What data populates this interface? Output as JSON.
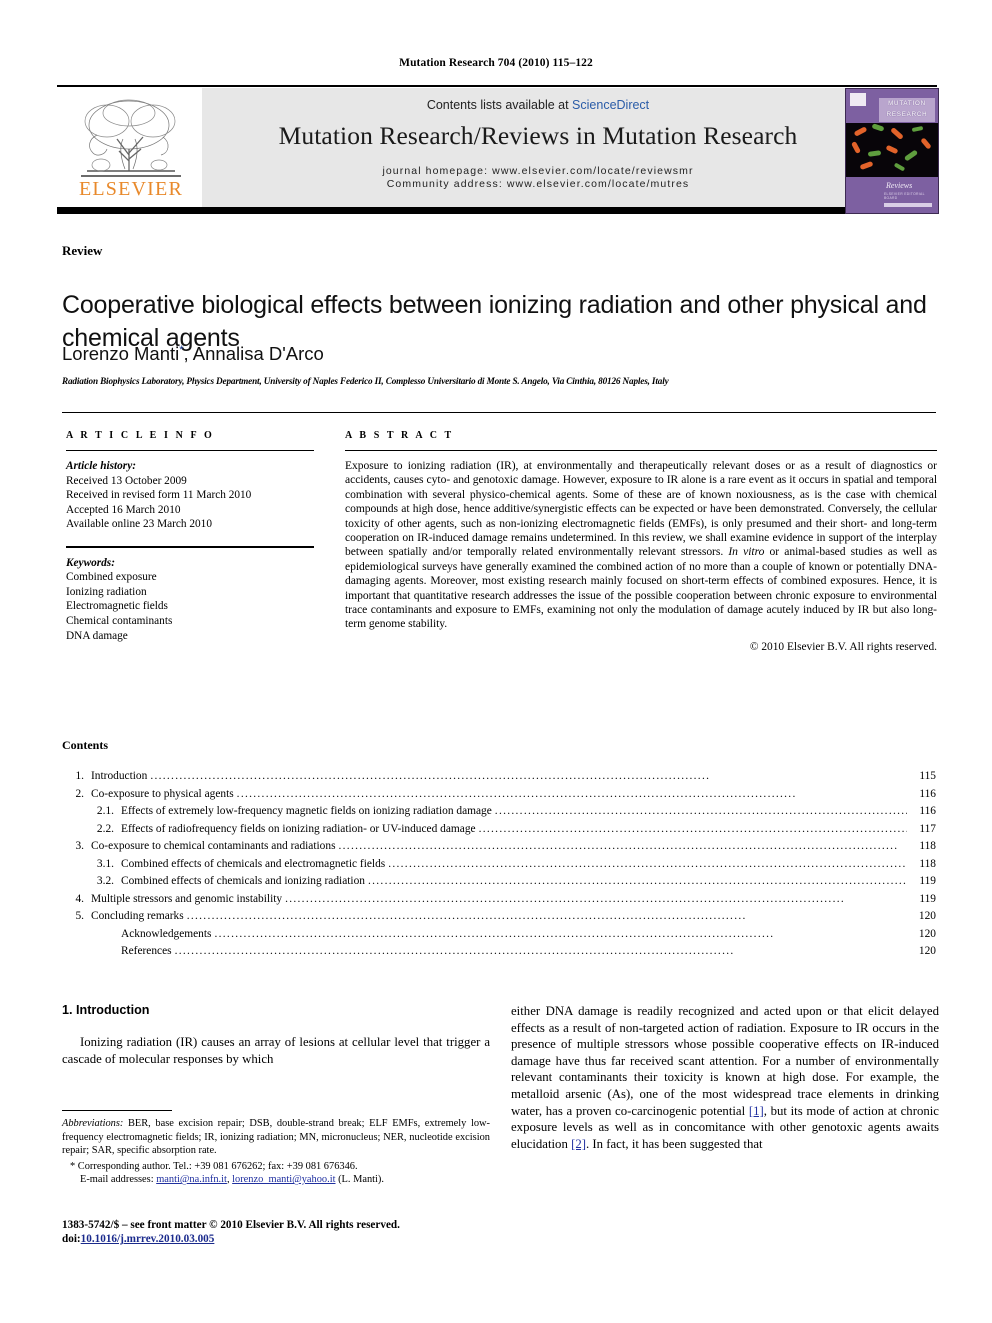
{
  "running_head": "Mutation Research 704 (2010) 115–122",
  "masthead": {
    "contents_prefix": "Contents lists available at ",
    "sciencedirect": "ScienceDirect",
    "journal_title": "Mutation Research/Reviews in Mutation Research",
    "homepage": "journal homepage: www.elsevier.com/locate/reviewsmr",
    "community": "Community address: www.elsevier.com/locate/mutres",
    "publisher_logo_text": "ELSEVIER",
    "accent_orange": "#e8892b",
    "band_gray": "#e7e7e7"
  },
  "cover": {
    "title_line1": "MUTATION",
    "title_line2": "RESEARCH",
    "reviews_label": "Reviews",
    "subtitle": "ELSEVIER EDITORIAL BOARD",
    "purple": "#7d60a1"
  },
  "article": {
    "type_label": "Review",
    "title": "Cooperative biological effects between ionizing radiation and other physical and chemical agents",
    "authors": "Lorenzo Manti",
    "author_marker": "*",
    "authors_rest": ", Annalisa D'Arco",
    "affiliation": "Radiation Biophysics Laboratory, Physics Department, University of Naples Federico II, Complesso Universitario di Monte S. Angelo, Via Cinthia, 80126 Naples, Italy"
  },
  "article_info": {
    "heading": "A R T I C L E   I N F O",
    "history_label": "Article history:",
    "history": [
      "Received 13 October 2009",
      "Received in revised form 11 March 2010",
      "Accepted 16 March 2010",
      "Available online 23 March 2010"
    ],
    "keywords_label": "Keywords:",
    "keywords": [
      "Combined exposure",
      "Ionizing radiation",
      "Electromagnetic fields",
      "Chemical contaminants",
      "DNA damage"
    ]
  },
  "abstract": {
    "heading": "A B S T R A C T",
    "part1": "Exposure to ionizing radiation (IR), at environmentally and therapeutically relevant doses or as a result of diagnostics or accidents, causes cyto- and genotoxic damage. However, exposure to IR alone is a rare event as it occurs in spatial and temporal combination with several physico-chemical agents. Some of these are of known noxiousness, as is the case with chemical compounds at high dose, hence additive/synergistic effects can be expected or have been demonstrated. Conversely, the cellular toxicity of other agents, such as non-ionizing electromagnetic fields (EMFs), is only presumed and their short- and long-term cooperation on IR-induced damage remains undetermined. In this review, we shall examine evidence in support of the interplay between spatially and/or temporally related environmentally relevant stressors. ",
    "italic1": "In vitro",
    "part2": " or animal-based studies as well as epidemiological surveys have generally examined the combined action of no more than a couple of known or potentially DNA-damaging agents. Moreover, most existing research mainly focused on short-term effects of combined exposures. Hence, it is important that quantitative research addresses the issue of the possible cooperation between chronic exposure to environmental trace contaminants and exposure to EMFs, examining not only the modulation of damage acutely induced by IR but also long-term genome stability.",
    "copyright": "© 2010 Elsevier B.V. All rights reserved."
  },
  "contents": {
    "heading": "Contents",
    "entries": [
      {
        "num": "1.",
        "label": "Introduction",
        "page": "115",
        "level": 1
      },
      {
        "num": "2.",
        "label": "Co-exposure to physical agents",
        "page": "116",
        "level": 1
      },
      {
        "num": "2.1.",
        "label": "Effects of extremely low-frequency magnetic fields on ionizing radiation damage",
        "page": "116",
        "level": 2
      },
      {
        "num": "2.2.",
        "label": "Effects of radiofrequency fields on ionizing radiation- or UV-induced damage",
        "page": "117",
        "level": 2
      },
      {
        "num": "3.",
        "label": "Co-exposure to chemical contaminants and radiations",
        "page": "118",
        "level": 1
      },
      {
        "num": "3.1.",
        "label": "Combined effects of chemicals and electromagnetic fields",
        "page": "118",
        "level": 2
      },
      {
        "num": "3.2.",
        "label": "Combined effects of chemicals and ionizing radiation",
        "page": "119",
        "level": 2
      },
      {
        "num": "4.",
        "label": "Multiple stressors and genomic instability",
        "page": "119",
        "level": 1
      },
      {
        "num": "5.",
        "label": "Concluding remarks",
        "page": "120",
        "level": 1
      },
      {
        "num": "",
        "label": "Acknowledgements",
        "page": "120",
        "level": 1
      },
      {
        "num": "",
        "label": "References",
        "page": "120",
        "level": 1
      }
    ]
  },
  "body": {
    "intro_heading": "1. Introduction",
    "left_para": "Ionizing radiation (IR) causes an array of lesions at cellular level that trigger a cascade of molecular responses by which",
    "right_para_a": "either DNA damage is readily recognized and acted upon or that elicit delayed effects as a result of non-targeted action of radiation. Exposure to IR occurs in the presence of multiple stressors whose possible cooperative effects on IR-induced damage have thus far received scant attention. For a number of environmentally relevant contaminants their toxicity is known at high dose. For example, the metalloid arsenic (As), one of the most widespread trace elements in drinking water, has a proven co-carcinogenic potential ",
    "ref1": "[1]",
    "right_para_b": ", but its mode of action at chronic exposure levels as well as in concomitance with other genotoxic agents awaits elucidation ",
    "ref2": "[2]",
    "right_para_c": ". In fact, it has been suggested that"
  },
  "footnotes": {
    "abbrev_label": "Abbreviations:",
    "abbrev_text": " BER, base excision repair; DSB, double-strand break; ELF EMFs, extremely low-frequency electromagnetic fields; IR, ionizing radiation; MN, micronucleus; NER, nucleotide excision repair; SAR, specific absorption rate.",
    "corresponding": "* Corresponding author. Tel.: +39 081 676262; fax: +39 081 676346.",
    "email_label": "E-mail addresses:",
    "email1": "manti@na.infn.it",
    "email_sep": ", ",
    "email2": "lorenzo_manti@yahoo.it",
    "email_suffix": " (L. Manti).",
    "issn_line": "1383-5742/$ – see front matter © 2010 Elsevier B.V. All rights reserved.",
    "doi_label": "doi:",
    "doi_value": "10.1016/j.mrrev.2010.03.005"
  }
}
